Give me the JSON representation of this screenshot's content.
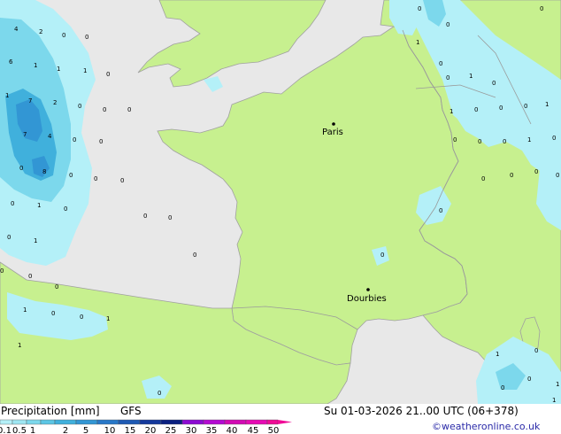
{
  "footer": {
    "title": "Precipitation [mm]",
    "model": "GFS",
    "datetime": "Su 01-03-2026 21..00 UTC (06+378)",
    "credit": "©weatheronline.co.uk"
  },
  "legend": {
    "labels": [
      "0.1",
      "0.5",
      "1",
      "2",
      "5",
      "10",
      "15",
      "20",
      "25",
      "30",
      "35",
      "40",
      "45",
      "50"
    ],
    "colors": [
      "#b4f0f8",
      "#9ee6f2",
      "#7cd8ec",
      "#5cc6e4",
      "#40b0dc",
      "#3296d4",
      "#2878c8",
      "#1e5ab4",
      "#14389c",
      "#0a2080",
      "#8c0ad2",
      "#b40ad2",
      "#d20ab4",
      "#e60ab4",
      "#f00a96"
    ]
  },
  "places": [
    {
      "name": "Paris"
    },
    {
      "name": "Dourbies"
    }
  ],
  "amounts": [
    "4",
    "2",
    "0",
    "0",
    "6",
    "1",
    "1",
    "1",
    "0",
    "1",
    "7",
    "2",
    "0",
    "0",
    "0",
    "7",
    "4",
    "0",
    "0",
    "0",
    "8",
    "0",
    "0",
    "0",
    "0",
    "1",
    "0",
    "0",
    "0",
    "0",
    "1",
    "0",
    "0",
    "0",
    "0",
    "1",
    "0",
    "0",
    "1",
    "1",
    "0",
    "0",
    "0",
    "1",
    "0",
    "0",
    "1",
    "0",
    "1",
    "0",
    "0",
    "0",
    "1",
    "0",
    "0",
    "0",
    "1",
    "0",
    "0",
    "0",
    "0",
    "0",
    "0",
    "0",
    "1",
    "0",
    "0",
    "0",
    "1",
    "1",
    "0"
  ],
  "colors": {
    "land": "#c7f08f",
    "sea": "#e8e8e8",
    "foreign": "#e6e6e6",
    "precip_light": "#b4f0f8",
    "precip_medium": "#7cd8ec",
    "precip_heavy": "#40b0dc",
    "precip_max": "#3296d4"
  }
}
